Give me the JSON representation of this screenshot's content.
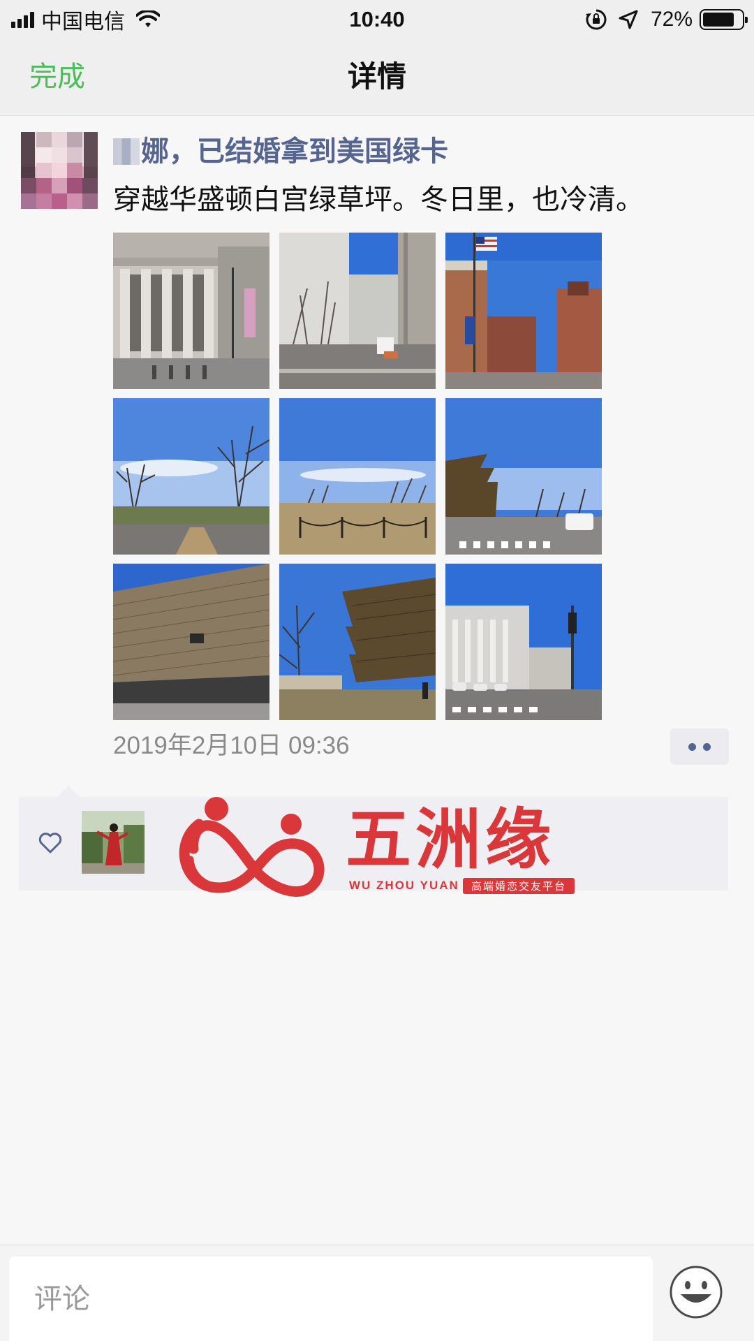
{
  "status_bar": {
    "carrier": "中国电信",
    "time": "10:40",
    "battery_percent": "72%",
    "battery_level": 0.72,
    "icons": [
      "signal-icon",
      "wifi-icon",
      "orientation-lock-icon",
      "location-icon",
      "battery-icon"
    ]
  },
  "nav": {
    "done_label": "完成",
    "title": "详情"
  },
  "post": {
    "author": "娜，已结婚拿到美国绿卡",
    "text": "穿越华盛顿白宫绿草坪。冬日里，也冷清。",
    "timestamp": "2019年2月10日 09:36",
    "photos": [
      "photo-columned-building",
      "photo-modern-building-and-checkpoint",
      "photo-brick-building-with-flag",
      "photo-bare-trees-and-sky",
      "photo-lawn-with-rope-fence",
      "photo-museum-and-street",
      "photo-bronze-museum-building",
      "photo-bronze-museum-with-tree",
      "photo-street-with-white-building"
    ]
  },
  "likes": {
    "icon": "heart-icon",
    "liker_count": 1
  },
  "watermark": {
    "title": "五洲缘",
    "subtitle": "WU ZHOU YUAN",
    "tagline": "高端婚恋交友平台"
  },
  "comment_bar": {
    "placeholder": "评论",
    "emoji_icon": "emoji-smile-icon"
  },
  "colors": {
    "accent_green": "#4cbc5a",
    "author_blue": "#56658f",
    "watermark_red": "#d9373a",
    "timestamp_gray": "#8a8a8a"
  }
}
